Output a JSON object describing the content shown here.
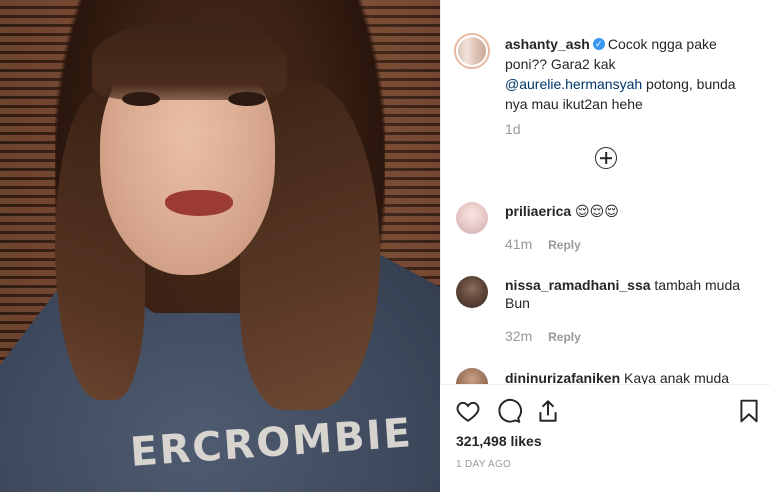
{
  "post": {
    "username": "ashanty_ash",
    "caption_before_mention": "Cocok ngga pake poni?? Gara2 kak ",
    "mention": "@aurelie.hermansyah",
    "caption_after_mention": " potong, bunda nya mau ikut2an hehe",
    "time": "1d",
    "likes": "321,498 likes",
    "posted_ago": "1 DAY AGO",
    "photo_shirt_text": "ERCROMBIE"
  },
  "comments": [
    {
      "user": "priliaerica",
      "text": "😌😌😌",
      "time": "41m",
      "reply": "Reply"
    },
    {
      "user": "nissa_ramadhani_ssa",
      "text": "tambah muda Bun",
      "time": "32m",
      "reply": "Reply"
    },
    {
      "user": "dininurizafaniken",
      "text": "Kaya anak muda"
    }
  ],
  "icons": {
    "verified": "verified-badge-icon",
    "load_more": "plus-circle-icon",
    "like": "heart-icon",
    "comment": "comment-icon",
    "share": "share-icon",
    "save": "bookmark-icon"
  },
  "colors": {
    "verified": "#3897f0",
    "mention": "#003569",
    "muted": "#999999"
  }
}
